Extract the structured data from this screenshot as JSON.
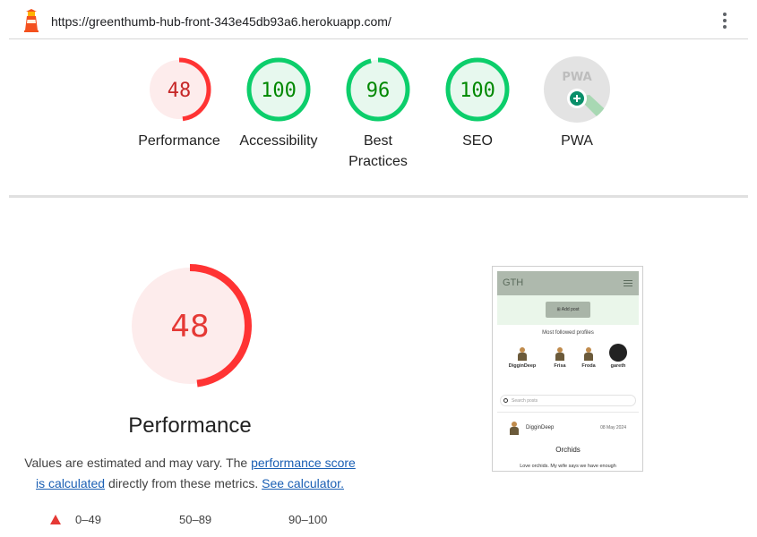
{
  "topbar": {
    "url": "https://greenthumb-hub-front-343e45db93a6.herokuapp.com/",
    "logo_icon": "lighthouse-icon",
    "menu_icon": "kebab-menu-icon"
  },
  "gauges": [
    {
      "label": "Performance",
      "score": 48,
      "score_text": "48",
      "status": "fail"
    },
    {
      "label": "Accessibility",
      "score": 100,
      "score_text": "100",
      "status": "pass"
    },
    {
      "label": "Best Practices",
      "score": 96,
      "score_text": "96",
      "status": "pass"
    },
    {
      "label": "SEO",
      "score": 100,
      "score_text": "100",
      "status": "pass"
    },
    {
      "label": "PWA",
      "score": null,
      "score_text": "PWA",
      "status": "na"
    }
  ],
  "colors": {
    "fail": "#ff3333",
    "fail_bg": "#fdecec",
    "fail_text": "#c62828",
    "pass": "#0cce6b",
    "pass_bg": "#e7f8ee",
    "pass_text": "#008800",
    "pwa_bg": "#e3e3e3",
    "link": "#1a5fb4"
  },
  "performance": {
    "score_text": "48",
    "score": 48,
    "title": "Performance",
    "note_prefix": "Values are estimated and may vary. The ",
    "note_link1": "performance score is calculated",
    "note_middle": " directly from these metrics. ",
    "note_link2": "See calculator."
  },
  "legend": {
    "fail_range": "0–49",
    "average_range": "50–89",
    "pass_range": "90–100"
  },
  "screenshot": {
    "logo": "GTH",
    "add_post_label": "Add post",
    "most_followed_label": "Most followed profiles",
    "profiles": [
      "DigginDeep",
      "Frisa",
      "Froda",
      "gareth"
    ],
    "search_placeholder": "Search posts",
    "post_author": "DigginDeep",
    "post_date": "08 May 2024",
    "post_title": "Orchids",
    "post_text": "Love orchids. My wife says we have enough"
  }
}
